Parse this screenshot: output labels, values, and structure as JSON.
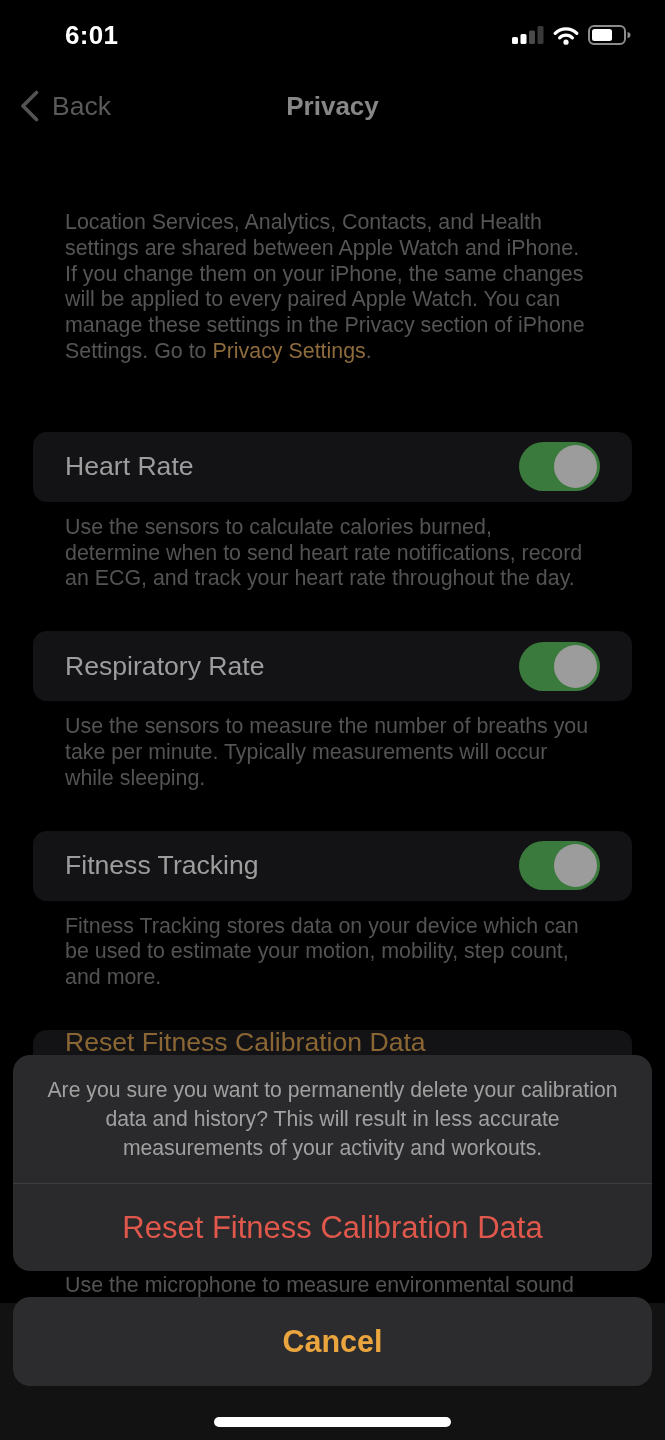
{
  "status_bar": {
    "time": "6:01"
  },
  "nav_bar": {
    "back": "Back",
    "title": "Privacy"
  },
  "intro": {
    "text": "Location Services, Analytics, Contacts, and Health settings are shared between Apple Watch and iPhone. If you change them on your iPhone, the same changes will be applied to every paired Apple Watch. You can manage these settings in the Privacy section of iPhone Settings. Go to",
    "link": "Privacy Settings",
    "after": "."
  },
  "settings": [
    {
      "kind": "toggle",
      "label": "Heart Rate",
      "on": true
    },
    {
      "kind": "caption",
      "text": "Use the sensors to calculate calories burned, determine when to send heart rate notifications, record an ECG, and track your heart rate throughout the day."
    },
    {
      "kind": "toggle",
      "label": "Respiratory Rate",
      "on": true
    },
    {
      "kind": "caption",
      "text": "Use the sensors to measure the number of breaths you take per minute. Typically measurements will occur while sleeping."
    },
    {
      "kind": "toggle",
      "label": "Fitness Tracking",
      "on": true
    },
    {
      "kind": "caption",
      "text": "Fitness Tracking stores data on your device which can be used to estimate your motion, mobility, step count, and more."
    },
    {
      "kind": "action",
      "label": "Reset Fitness Calibration Data"
    },
    {
      "kind": "caption",
      "text": "Use the microphone to measure environmental sound"
    }
  ],
  "action_sheet": {
    "message": "Are you sure you want to permanently delete your calibration data and history? This will result in less accurate measurements of your activity and workouts.",
    "actions": [
      {
        "label": "Reset Fitness Calibration Data",
        "kind": "destructive"
      }
    ],
    "cancel": "Cancel"
  }
}
